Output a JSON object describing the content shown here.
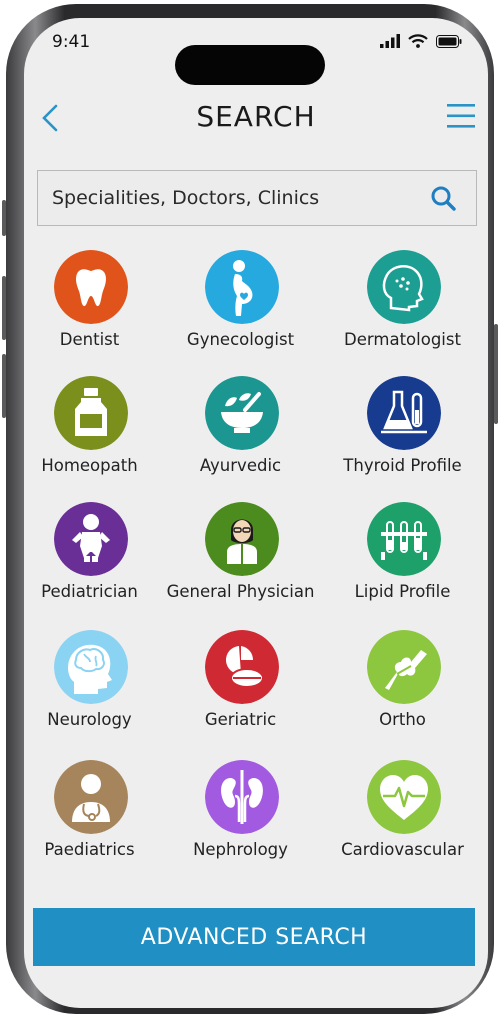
{
  "status": {
    "time": "9:41"
  },
  "header": {
    "title": "SEARCH"
  },
  "search": {
    "placeholder": "Specialities, Doctors, Clinics"
  },
  "colors": {
    "accent": "#2a93c7",
    "button": "#1f8fc4"
  },
  "categories": [
    {
      "label": "Dentist",
      "color": "#e0541b",
      "icon": "tooth-icon"
    },
    {
      "label": "Gynecologist",
      "color": "#26a9df",
      "icon": "pregnancy-icon"
    },
    {
      "label": "Dermatologist",
      "color": "#1d9e93",
      "icon": "skin-face-icon"
    },
    {
      "label": "Homeopath",
      "color": "#7a8f1c",
      "icon": "medicine-bottle-icon"
    },
    {
      "label": "Ayurvedic",
      "color": "#1c9690",
      "icon": "mortar-pestle-icon"
    },
    {
      "label": "Thyroid Profile",
      "color": "#173b8f",
      "icon": "lab-flasks-icon"
    },
    {
      "label": "Pediatrician",
      "color": "#6a2f97",
      "icon": "baby-icon"
    },
    {
      "label": "General Physician",
      "color": "#4c8c1f",
      "icon": "doctor-icon"
    },
    {
      "label": "Lipid Profile",
      "color": "#1ea06a",
      "icon": "test-tubes-icon"
    },
    {
      "label": "Neurology",
      "color": "#8ad3f2",
      "icon": "brain-head-icon"
    },
    {
      "label": "Geriatric",
      "color": "#cf2a33",
      "icon": "pills-icon"
    },
    {
      "label": "Ortho",
      "color": "#8dc63f",
      "icon": "bone-joint-icon"
    },
    {
      "label": "Paediatrics",
      "color": "#a6855c",
      "icon": "stethoscope-doctor-icon"
    },
    {
      "label": "Nephrology",
      "color": "#a25be0",
      "icon": "kidneys-icon"
    },
    {
      "label": "Cardiovascular",
      "color": "#8dc63f",
      "icon": "heartbeat-icon"
    }
  ],
  "advanced_search": {
    "label": "ADVANCED SEARCH"
  }
}
